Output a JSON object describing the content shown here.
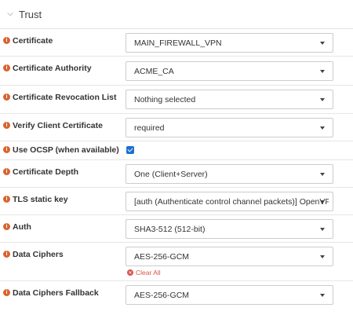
{
  "section": {
    "title": "Trust",
    "chevron_icon": "chevron-down-icon"
  },
  "rows": [
    {
      "label": "Certificate",
      "value": "MAIN_FIREWALL_VPN"
    },
    {
      "label": "Certificate Authority",
      "value": "ACME_CA"
    },
    {
      "label": "Certificate Revocation List",
      "value": "Nothing selected"
    },
    {
      "label": "Verify Client Certificate",
      "value": "required"
    },
    {
      "label": "Use OCSP (when available)",
      "checked": true
    },
    {
      "label": "Certificate Depth",
      "value": "One (Client+Server)"
    },
    {
      "label": "TLS static key",
      "value": "[auth (Authenticate control channel packets)] OpenVPN"
    },
    {
      "label": "Auth",
      "value": "SHA3-512 (512-bit)"
    },
    {
      "label": "Data Ciphers",
      "value": "AES-256-GCM",
      "clear_label": "Clear All"
    },
    {
      "label": "Data Ciphers Fallback",
      "value": "AES-256-GCM"
    }
  ],
  "colors": {
    "info_icon": "#d9632f",
    "checkbox": "#1a6fd2",
    "clear_all": "#d9534f"
  }
}
